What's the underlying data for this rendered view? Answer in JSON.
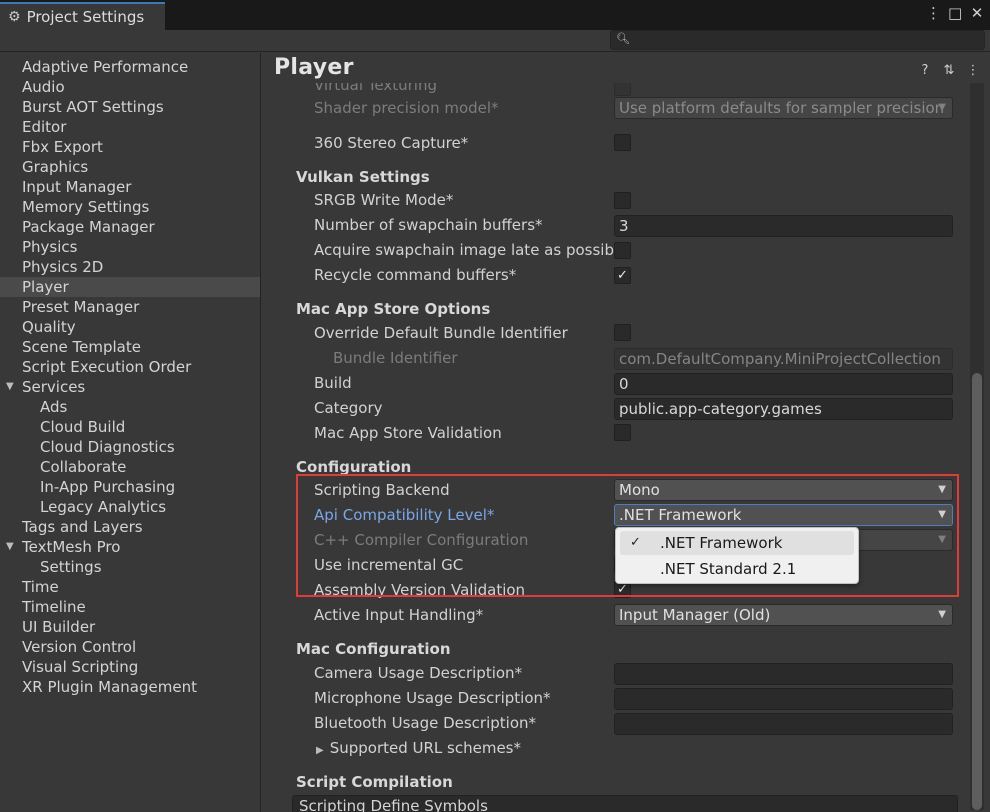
{
  "window": {
    "tab_title": "Project Settings",
    "icons": [
      "kebab-menu-icon",
      "maximize-icon",
      "close-icon"
    ]
  },
  "search": {
    "placeholder": "",
    "icon": "search-icon"
  },
  "sidebar": {
    "items": [
      {
        "label": "Adaptive Performance"
      },
      {
        "label": "Audio"
      },
      {
        "label": "Burst AOT Settings"
      },
      {
        "label": "Editor"
      },
      {
        "label": "Fbx Export"
      },
      {
        "label": "Graphics"
      },
      {
        "label": "Input Manager"
      },
      {
        "label": "Memory Settings"
      },
      {
        "label": "Package Manager"
      },
      {
        "label": "Physics"
      },
      {
        "label": "Physics 2D"
      },
      {
        "label": "Player",
        "selected": true
      },
      {
        "label": "Preset Manager"
      },
      {
        "label": "Quality"
      },
      {
        "label": "Scene Template"
      },
      {
        "label": "Script Execution Order"
      },
      {
        "label": "Services",
        "expanded": true
      },
      {
        "label": "Ads",
        "sub": true
      },
      {
        "label": "Cloud Build",
        "sub": true
      },
      {
        "label": "Cloud Diagnostics",
        "sub": true
      },
      {
        "label": "Collaborate",
        "sub": true
      },
      {
        "label": "In-App Purchasing",
        "sub": true
      },
      {
        "label": "Legacy Analytics",
        "sub": true
      },
      {
        "label": "Tags and Layers"
      },
      {
        "label": "TextMesh Pro",
        "expanded": true
      },
      {
        "label": "Settings",
        "sub": true
      },
      {
        "label": "Time"
      },
      {
        "label": "Timeline"
      },
      {
        "label": "UI Builder"
      },
      {
        "label": "Version Control"
      },
      {
        "label": "Visual Scripting"
      },
      {
        "label": "XR Plugin Management"
      }
    ]
  },
  "main": {
    "title": "Player",
    "header_icons": [
      "help-icon",
      "preset-icon",
      "kebab-menu-icon"
    ],
    "rows": {
      "virtual_texturing": "Virtual Texturing",
      "shader_precision_label": "Shader precision model*",
      "shader_precision_value": "Use platform defaults for sampler precision",
      "stereo_capture_label": "360 Stereo Capture*",
      "vulkan_section": "Vulkan Settings",
      "srgb_label": "SRGB Write Mode*",
      "swapchain_label": "Number of swapchain buffers*",
      "swapchain_value": "3",
      "acquire_label": "Acquire swapchain image late as possible*",
      "recycle_label": "Recycle command buffers*",
      "mac_store_section": "Mac App Store Options",
      "override_bundle_label": "Override Default Bundle Identifier",
      "bundle_id_label": "Bundle Identifier",
      "bundle_id_value": "com.DefaultCompany.MiniProjectCollection",
      "build_label": "Build",
      "build_value": "0",
      "category_label": "Category",
      "category_value": "public.app-category.games",
      "store_validation_label": "Mac App Store Validation",
      "config_section": "Configuration",
      "scripting_backend_label": "Scripting Backend",
      "scripting_backend_value": "Mono",
      "api_level_label": "Api Compatibility Level*",
      "api_level_value": ".NET Framework",
      "cpp_compiler_label": "C++ Compiler Configuration",
      "incremental_gc_label": "Use incremental GC",
      "assembly_validation_label": "Assembly Version Validation",
      "input_handling_label": "Active Input Handling*",
      "input_handling_value": "Input Manager (Old)",
      "mac_config_section": "Mac Configuration",
      "camera_usage_label": "Camera Usage Description*",
      "microphone_usage_label": "Microphone Usage Description*",
      "bluetooth_usage_label": "Bluetooth Usage Description*",
      "url_schemes_label": "Supported URL schemes*",
      "script_compilation_section": "Script Compilation",
      "define_symbols_label": "Scripting Define Symbols"
    },
    "checkmark": "✓",
    "popup": {
      "options": [
        {
          "label": ".NET Framework",
          "selected": true
        },
        {
          "label": ".NET Standard 2.1",
          "selected": false
        }
      ]
    }
  },
  "colors": {
    "accent_blue": "#7aa6e8",
    "highlight_red": "#e03a3a",
    "panel_bg": "#383838",
    "titlebar_bg": "#191919"
  }
}
